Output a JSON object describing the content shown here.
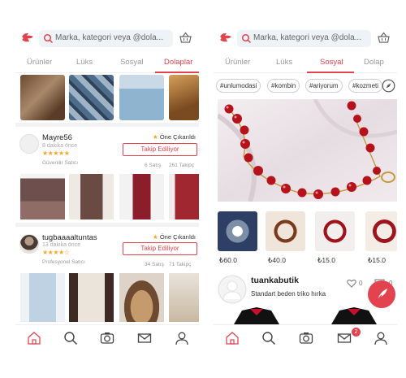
{
  "screen_a": {
    "search_placeholder": "Marka, kategori veya @dola...",
    "tabs": [
      {
        "label": "Ürünler"
      },
      {
        "label": "Lüks"
      },
      {
        "label": "Sosyal"
      },
      {
        "label": "Dolaplar"
      }
    ],
    "active_tab": "Dolaplar",
    "sellers": [
      {
        "name": "Mayre56",
        "time": "8 dakika önce",
        "stars": "★★★★★",
        "type": "Güvenilir Satıcı",
        "featured": "Öne Çıkarıldı",
        "follow_label": "Takip Ediliyor",
        "sales": "6 Satış",
        "followers": "261 Takipç"
      },
      {
        "name": "tugbaaaaltuntas",
        "time": "13 dakika önce",
        "stars": "★★★★☆",
        "type": "Profesyonel Satıcı",
        "featured": "Öne Çıkarıldı",
        "follow_label": "Takip Ediliyor",
        "sales": "34 Satış",
        "followers": "71 Takipç"
      }
    ]
  },
  "screen_b": {
    "search_placeholder": "Marka, kategori veya @dola...",
    "tabs": [
      {
        "label": "Ürünler"
      },
      {
        "label": "Lüks"
      },
      {
        "label": "Sosyal"
      },
      {
        "label": "Dolap"
      }
    ],
    "active_tab": "Sosyal",
    "hashtags": [
      "#unlumodasi",
      "#kombin",
      "#ariyorum",
      "#kozmeti"
    ],
    "prices": [
      "₺60.0",
      "₺40.0",
      "₺15.0",
      "₺15.0"
    ],
    "likes": "0",
    "comments": "0",
    "shop_name": "tuankabutik",
    "shop_desc": "Standart beden triko hırka",
    "message_badge": "2"
  },
  "colors": {
    "accent": "#e2434f",
    "star": "#f5a623",
    "search_bg": "#edf3f6"
  },
  "icons": [
    "logo-icon",
    "search-icon",
    "basket-icon",
    "home-icon",
    "camera-icon",
    "mail-icon",
    "profile-icon",
    "compass-icon",
    "heart-icon",
    "comment-icon",
    "feather-icon",
    "user-placeholder-icon"
  ]
}
